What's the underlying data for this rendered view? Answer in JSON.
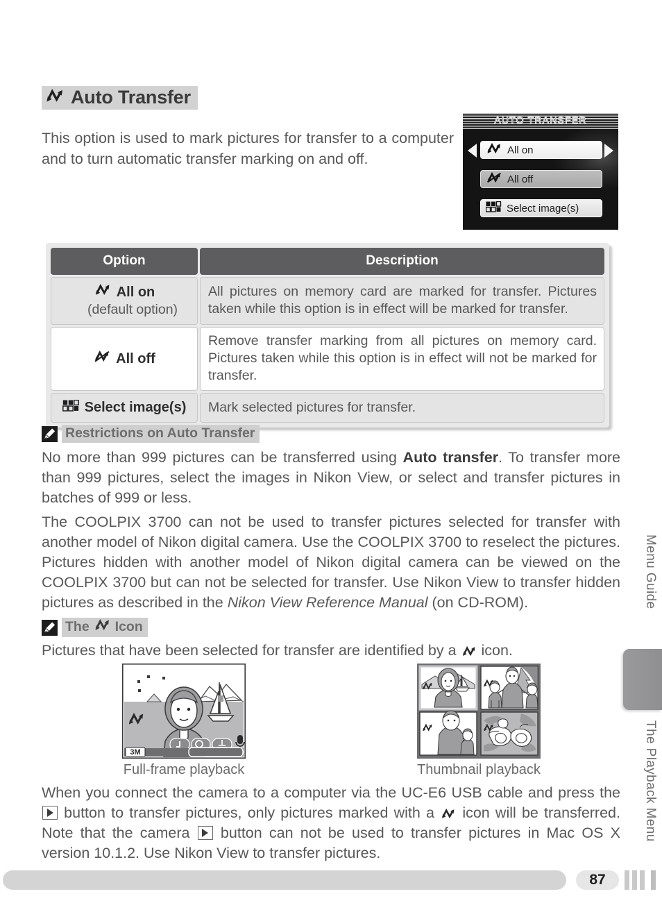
{
  "page": {
    "number": "87",
    "side_labels": [
      "Menu Guide",
      "The Playback Menu"
    ]
  },
  "section": {
    "title": "Auto Transfer",
    "title_icon": "transfer-icon",
    "intro": "This option is used to mark pictures for transfer to a computer and to turn automatic transfer marking on and off."
  },
  "lcd": {
    "title": "AUTO TRANSFER",
    "items": [
      {
        "label": "All on",
        "icon": "transfer-icon",
        "selected": true
      },
      {
        "label": "All off",
        "icon": "transfer-off-icon",
        "selected": false
      },
      {
        "label": "Select image(s)",
        "icon": "thumbnail-grid-icon",
        "selected": false
      }
    ],
    "left_arrow": "left-arrow-icon",
    "right_arrow": "right-arrow-icon"
  },
  "table": {
    "headers": [
      "Option",
      "Description"
    ],
    "rows": [
      {
        "option": "All on",
        "option_sub": "(default option)",
        "icon": "transfer-icon",
        "description": "All pictures on memory card are marked for transfer.  Pictures taken while this option is in effect will be marked for transfer."
      },
      {
        "option": "All off",
        "option_sub": "",
        "icon": "transfer-off-icon",
        "description": "Remove transfer marking from all pictures on memory card. Pictures taken while this option is in effect will not be marked for transfer."
      },
      {
        "option": "Select image(s)",
        "option_sub": "",
        "icon": "thumbnail-grid-icon",
        "description": "Mark selected pictures for transfer."
      }
    ]
  },
  "notes": [
    {
      "heading_pre": "Restrictions on Auto Transfer",
      "heading_icon": "pencil-icon",
      "paragraphs": [
        "No more than 999 pictures can be transferred using <b>Auto transfer</b>.  To transfer more than 999 pictures, select the images in Nikon View, or select and transfer pictures in batches of 999 or less.",
        "The COOLPIX 3700 can not be used to transfer pictures selected for transfer with another model of Nikon digital camera.  Use the COOLPIX 3700 to reselect the pictures. Pictures hidden with another model of Nikon digital camera can be viewed on the COOLPIX 3700 but can not be selected for transfer.  Use Nikon View to transfer hidden pictures as described in the <i>Nikon View Reference Manual</i> (on CD-ROM)."
      ]
    },
    {
      "heading_pre": "The",
      "heading_post": "Icon",
      "heading_icon": "pencil-icon",
      "heading_inline_icon": "transfer-icon",
      "paragraphs": [
        "Pictures that have been selected for transfer are identified by a <span class=\"inline-ico\"></span> icon."
      ]
    }
  ],
  "figures": {
    "left_caption": "Full-frame playback",
    "right_caption": "Thumbnail playback",
    "full_frame_badge": "3M"
  },
  "closing_paragraph": "When you connect the camera to a computer via the UC-E6 USB cable and press the <span class=\"playbtn\"></span> button to transfer pictures, only pictures marked with a <span class=\"inline-ico\"></span> icon will be transferred. Note that the camera <span class=\"playbtn\"></span> button can not be used to transfer pictures in Mac OS X version 10.1.2.  Use Nikon View to transfer pictures.",
  "colors": {
    "body_text": "#58585a",
    "heading_highlight": "#d2d2d2",
    "table_header": "#5d5d5f",
    "row_shade": "#e4e4e4",
    "lcd_background": "#1a1a1a"
  }
}
